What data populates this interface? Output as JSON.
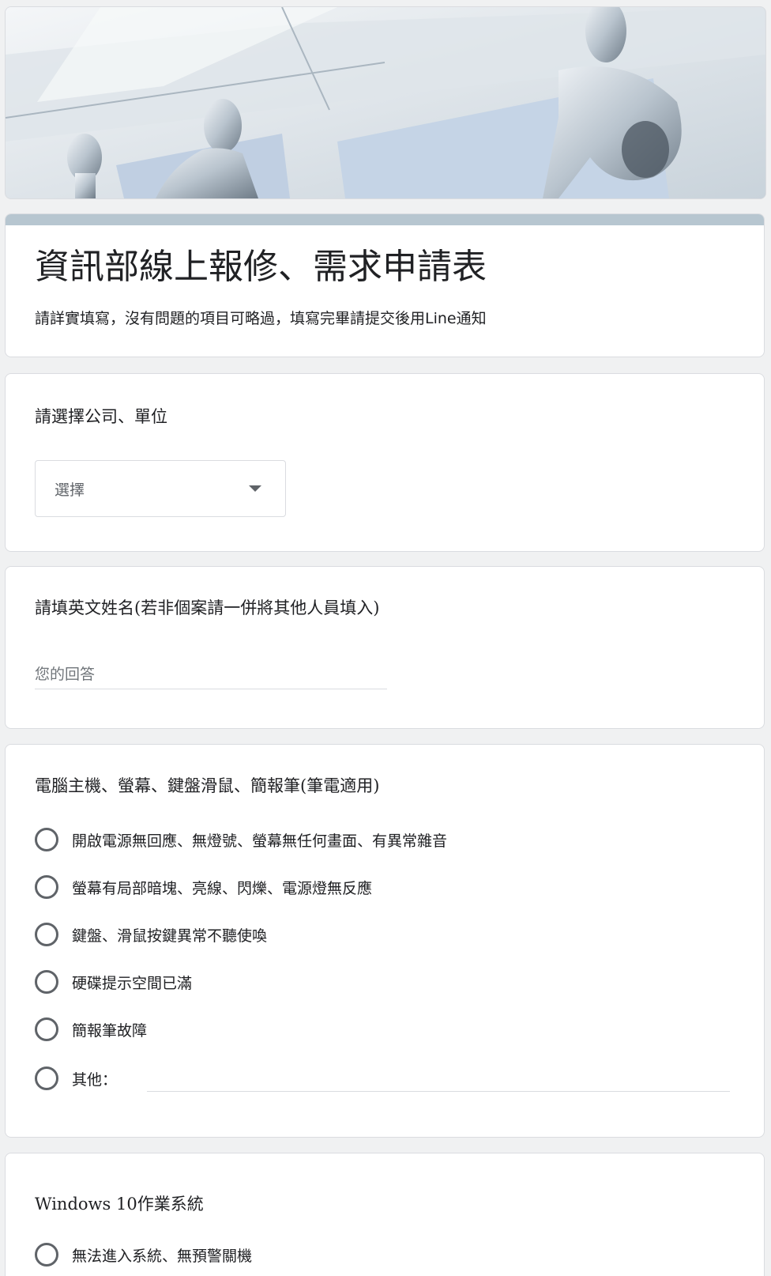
{
  "form": {
    "title": "資訊部線上報修、需求申請表",
    "description": "請詳實填寫，沒有問題的項目可略過，填寫完畢請提交後用Line通知"
  },
  "q_company": {
    "title": "請選擇公司、單位",
    "select_value": "選擇"
  },
  "q_name": {
    "title": "請填英文姓名(若非個案請一併將其他人員填入)",
    "placeholder": "您的回答"
  },
  "q_pc": {
    "title": "電腦主機、螢幕、鍵盤滑鼠、簡報筆(筆電適用)",
    "options": [
      "開啟電源無回應、無燈號、螢幕無任何畫面、有異常雜音",
      "螢幕有局部暗塊、亮線、閃爍、電源燈無反應",
      "鍵盤、滑鼠按鍵異常不聽使喚",
      "硬碟提示空間已滿",
      "簡報筆故障",
      "其他："
    ]
  },
  "q_windows": {
    "title": "Windows 10作業系統",
    "options": [
      "無法進入系統、無預警關機"
    ]
  },
  "colors": {
    "accent_bar": "#b7c6d0",
    "radio_border": "#5f6368"
  }
}
